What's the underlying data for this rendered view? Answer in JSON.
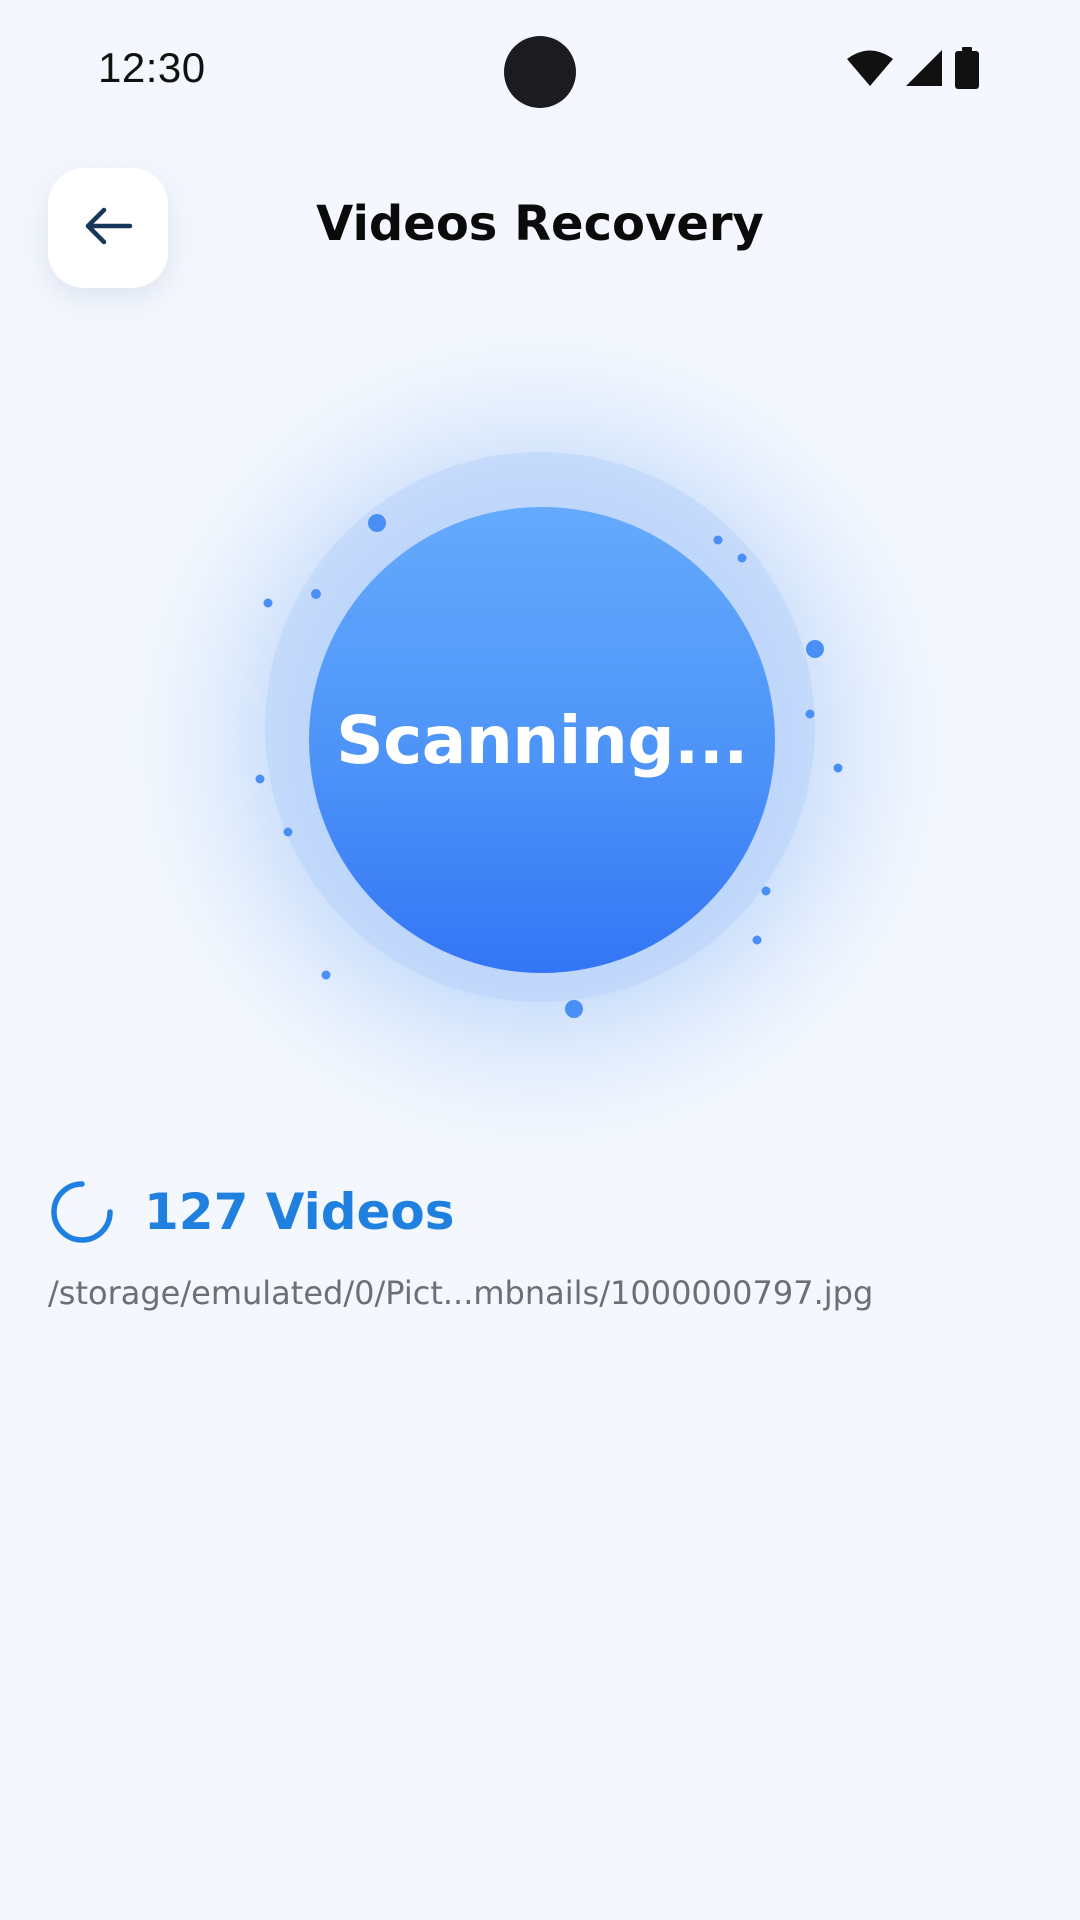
{
  "status_bar": {
    "time": "12:30",
    "icons": [
      "wifi-icon",
      "cellular-signal-icon",
      "battery-icon"
    ]
  },
  "header": {
    "back_icon": "arrow-left-icon",
    "title": "Videos Recovery"
  },
  "scanner": {
    "label": "Scanning..."
  },
  "progress": {
    "count_label": "127 Videos",
    "current_path": "/storage/emulated/0/Pict...mbnails/1000000797.jpg"
  },
  "colors": {
    "background": "#f4f7fd",
    "accent": "#1f80e0",
    "scan_gradient_top": "#64aafc",
    "scan_gradient_bottom": "#3375f5",
    "particle": "#4a8ff5"
  }
}
